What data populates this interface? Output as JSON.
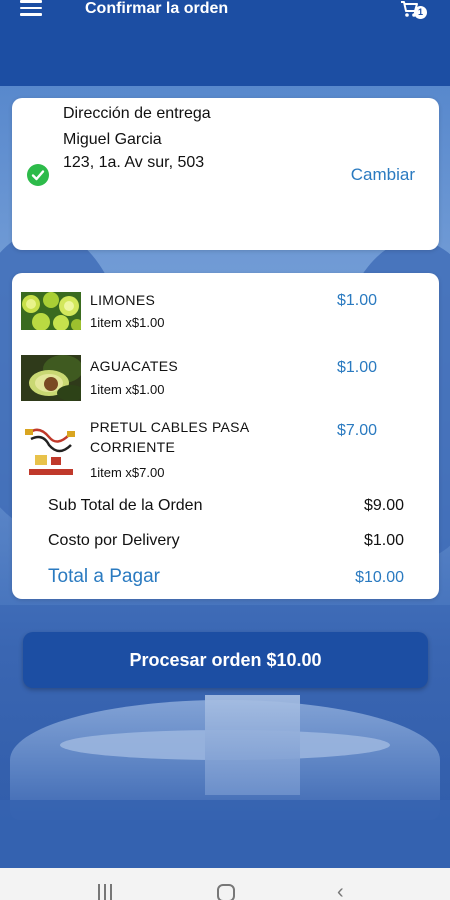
{
  "header": {
    "title": "Confirmar la orden",
    "cart_count": "1"
  },
  "address": {
    "title": "Dirección de entrega",
    "name": "Miguel Garcia",
    "line": "123, 1a. Av sur, 503",
    "change_label": "Cambiar"
  },
  "items": [
    {
      "name": "LIMONES",
      "qty": "1item x$1.00",
      "price": "$1.00",
      "icon": "lemons-image"
    },
    {
      "name": "AGUACATES",
      "qty": "1item x$1.00",
      "price": "$1.00",
      "icon": "avocado-image"
    },
    {
      "name": "PRETUL CABLES PASA CORRIENTE",
      "qty": "1item x$7.00",
      "price": "$7.00",
      "icon": "jumper-cables-image"
    }
  ],
  "summary": {
    "subtotal_label": "Sub Total de la Orden",
    "subtotal_value": "$9.00",
    "delivery_label": "Costo por Delivery",
    "delivery_value": "$1.00",
    "total_label": "Total a Pagar",
    "total_value": "$10.00"
  },
  "process_button": "Procesar orden  $10.00",
  "colors": {
    "brand": "#1c4ea3",
    "link": "#2a7ac0",
    "success": "#2dbb4a"
  }
}
